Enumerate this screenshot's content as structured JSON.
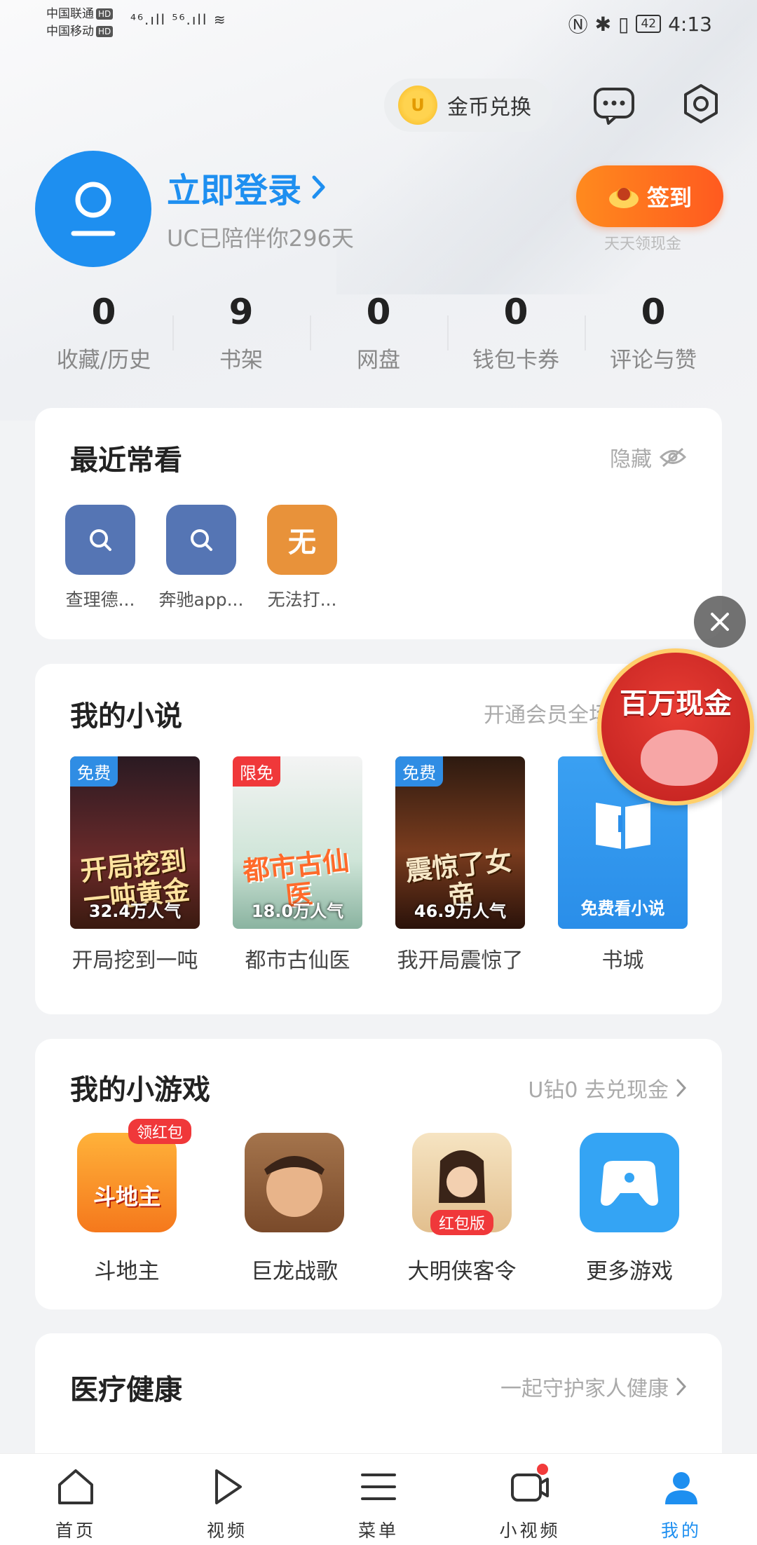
{
  "status_bar": {
    "carrier1": "中国联通",
    "carrier2": "中国移动",
    "hd": "HD",
    "signal": "⁴⁶.ıll ⁵⁶.ıll",
    "battery": "42",
    "time": "4:13"
  },
  "header": {
    "coin_label": "金币兑换",
    "coin_symbol": "U"
  },
  "profile": {
    "login_label": "立即登录",
    "subtitle": "UC已陪伴你296天",
    "signin_label": "签到",
    "signin_sub": "天天领现金"
  },
  "stats": [
    {
      "value": "0",
      "label": "收藏/历史"
    },
    {
      "value": "9",
      "label": "书架"
    },
    {
      "value": "0",
      "label": "网盘"
    },
    {
      "value": "0",
      "label": "钱包卡券"
    },
    {
      "value": "0",
      "label": "评论与赞"
    }
  ],
  "recent": {
    "title": "最近常看",
    "hide_label": "隐藏",
    "items": [
      {
        "label": "查理德...",
        "icon": "search-icon",
        "glyph": "",
        "color": "#5575b4"
      },
      {
        "label": "奔驰app...",
        "icon": "search-icon",
        "glyph": "",
        "color": "#5575b4"
      },
      {
        "label": "无法打...",
        "icon": "letter-icon",
        "glyph": "无",
        "color": "#e8923a"
      }
    ]
  },
  "novels": {
    "title": "我的小说",
    "aside": "开通会员全场免",
    "books": [
      {
        "tag": "免费",
        "tag_color": "#2f8de4",
        "cover_text": "开局挖到一吨黄金",
        "popularity": "32.4万人气",
        "label": "开局挖到一吨",
        "bg": "linear-gradient(180deg,#2a1a22,#6b2a2a 60%,#3a1a10)"
      },
      {
        "tag": "限免",
        "tag_color": "#f0383a",
        "cover_text": "都市古仙医",
        "popularity": "18.0万人气",
        "label": "都市古仙医",
        "bg": "linear-gradient(180deg,#f4f4f4,#cfe5d8 60%,#8ab3a0)"
      },
      {
        "tag": "免费",
        "tag_color": "#2f8de4",
        "cover_text": "震惊了女帝",
        "popularity": "46.9万人气",
        "label": "我开局震惊了",
        "bg": "linear-gradient(180deg,#2d1a10,#7a3c1e 55%,#2a120a)"
      },
      {
        "tag": "",
        "tag_color": "",
        "cover_text": "",
        "popularity": "免费看小说",
        "label": "书城",
        "bg": "linear-gradient(180deg,#3aa0f2,#2a8ee9)"
      }
    ]
  },
  "games": {
    "title": "我的小游戏",
    "aside": "U钻0 去兑现金",
    "items": [
      {
        "label": "斗地主",
        "badge": "领红包",
        "inner": "斗地主",
        "bg": "linear-gradient(180deg,#ffb23a,#f5781c)"
      },
      {
        "label": "巨龙战歌",
        "badge": "",
        "inner": "",
        "bg": "linear-gradient(180deg,#a4744c,#7a4a2a)"
      },
      {
        "label": "大明侠客令",
        "badge": "红包版",
        "inner": "",
        "bg": "linear-gradient(180deg,#f6e4c2,#e2bf8e)"
      },
      {
        "label": "更多游戏",
        "badge": "",
        "inner": "",
        "bg": "#34a4f4"
      }
    ]
  },
  "health": {
    "title": "医疗健康",
    "aside": "一起守护家人健康"
  },
  "promo": {
    "text": "百万现金"
  },
  "nav": [
    {
      "label": "首页",
      "icon": "home-icon"
    },
    {
      "label": "视频",
      "icon": "play-icon"
    },
    {
      "label": "菜单",
      "icon": "menu-icon"
    },
    {
      "label": "小视频",
      "icon": "camera-icon"
    },
    {
      "label": "我的",
      "icon": "profile-icon"
    }
  ],
  "colors": {
    "accent": "#1e8ff0",
    "orange": "#ff6a1f",
    "red_badge": "#f0383a"
  }
}
